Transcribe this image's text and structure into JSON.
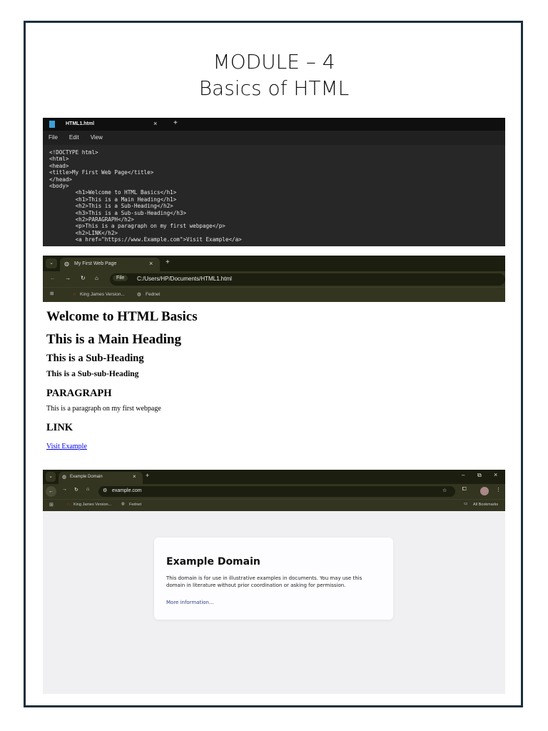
{
  "page": {
    "title_line1": "MODULE – 4",
    "title_line2": "Basics of HTML"
  },
  "editor": {
    "tab": "HTML1.html",
    "close": "×",
    "new_tab": "+",
    "menu": [
      "File",
      "Edit",
      "View"
    ],
    "code": [
      "<!DOCTYPE html>",
      "<html>",
      "<head>",
      "<title>My First Web Page</title>",
      "</head>",
      "<body>",
      "        <h1>Welcome to HTML Basics</h1>",
      "        <h1>This is a Main Heading</h1>",
      "        <h2>This is a Sub-Heading</h2>",
      "        <h3>This is a Sub-sub-Heading</h3>",
      "        <h2>PARAGRAPH</h2>",
      "        <p>This is a paragraph on my first webpage</p>",
      "        <h2>LINK</h2>",
      "        <a href=\"https://www.Example.com\">Visit Example</a>"
    ]
  },
  "browser1": {
    "tab": "My First Web Page",
    "close": "×",
    "new_tab": "+",
    "chip": "File",
    "url": "C:/Users/HP/Documents/HTML1.html",
    "bookmarks": [
      "King James Version...",
      "Fednet"
    ],
    "content": {
      "h1a": "Welcome to HTML Basics",
      "h1b": "This is a Main Heading",
      "h2": "This is a Sub-Heading",
      "h3": "This is a Sub-sub-Heading",
      "h2p": "PARAGRAPH",
      "p": "This is a paragraph on my first webpage",
      "h2l": "LINK",
      "link": "Visit Example"
    }
  },
  "browser2": {
    "tab": "Example Domain",
    "close": "×",
    "new_tab": "+",
    "url": "example.com",
    "bookmarks": [
      "King James Version...",
      "Fednet"
    ],
    "all_bookmarks": "All Bookmarks",
    "win": [
      "–",
      "⧉",
      "×"
    ],
    "card": {
      "title": "Example Domain",
      "body": "This domain is for use in illustrative examples in documents. You may use this domain in literature without prior coordination or asking for permission.",
      "link": "More information..."
    }
  },
  "colors": {
    "frame": "#1c2f3c",
    "link": "#0000ee",
    "card_link": "#334488"
  }
}
